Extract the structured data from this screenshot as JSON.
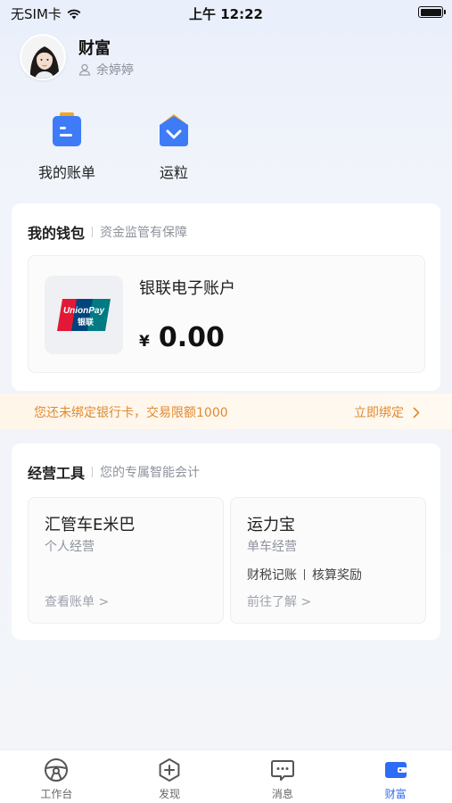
{
  "status_bar": {
    "carrier": "无SIM卡",
    "time": "上午 12:22"
  },
  "profile": {
    "title": "财富",
    "username": "余婷婷"
  },
  "quick_actions": [
    {
      "label": "我的账单",
      "icon": "bill-icon"
    },
    {
      "label": "运粒",
      "icon": "points-icon"
    }
  ],
  "wallet": {
    "title": "我的钱包",
    "subtitle": "资金监管有保障",
    "account_name": "银联电子账户",
    "currency": "¥",
    "balance": "0.00",
    "logo_text_top": "UnionPay",
    "logo_text_bottom": "银联"
  },
  "notice": {
    "text": "您还未绑定银行卡，交易限额1000",
    "link": "立即绑定"
  },
  "tools": {
    "title": "经营工具",
    "subtitle": "您的专属智能会计",
    "items": [
      {
        "title": "汇管车E米巴",
        "subtitle": "个人经营",
        "link": "查看账单 >"
      },
      {
        "title": "运力宝",
        "subtitle": "单车经营",
        "feature_1": "财税记账",
        "feature_2": "核算奖励",
        "link": "前往了解 >"
      }
    ]
  },
  "tabbar": [
    {
      "label": "工作台",
      "icon": "steering-wheel-icon"
    },
    {
      "label": "发现",
      "icon": "discover-icon"
    },
    {
      "label": "消息",
      "icon": "message-icon"
    },
    {
      "label": "财富",
      "icon": "wallet-icon",
      "active": true
    }
  ],
  "colors": {
    "accent": "#2e6cf6",
    "warning": "#e08a2f"
  }
}
